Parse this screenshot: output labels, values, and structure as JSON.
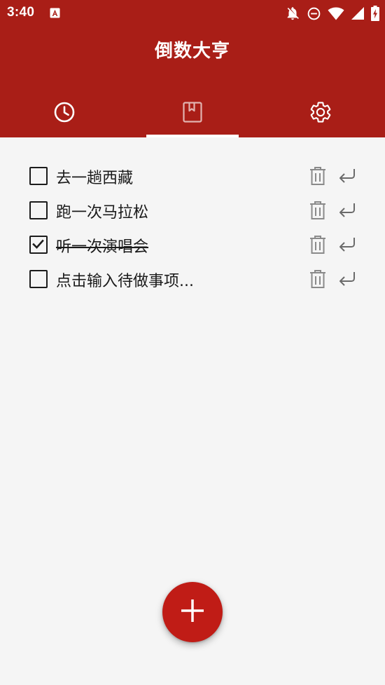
{
  "status_bar": {
    "time": "3:40",
    "icons": [
      "app-notification-icon",
      "bell-off-icon",
      "do-not-disturb-icon",
      "wifi-icon",
      "signal-icon",
      "battery-charging-icon"
    ]
  },
  "app": {
    "title": "倒数大亨"
  },
  "tabs": [
    {
      "id": "countdown",
      "icon": "clock-icon",
      "active": false
    },
    {
      "id": "todo",
      "icon": "bookmark-icon",
      "active": true
    },
    {
      "id": "settings",
      "icon": "gear-icon",
      "active": false
    }
  ],
  "todos": [
    {
      "text": "去一趟西藏",
      "checked": false
    },
    {
      "text": "跑一次马拉松",
      "checked": false
    },
    {
      "text": "听一次演唱会",
      "checked": true
    },
    {
      "text": "点击输入待做事项...",
      "checked": false
    }
  ],
  "colors": {
    "header": "#a91e17",
    "fab": "#c01c16",
    "background": "#f5f5f5"
  }
}
